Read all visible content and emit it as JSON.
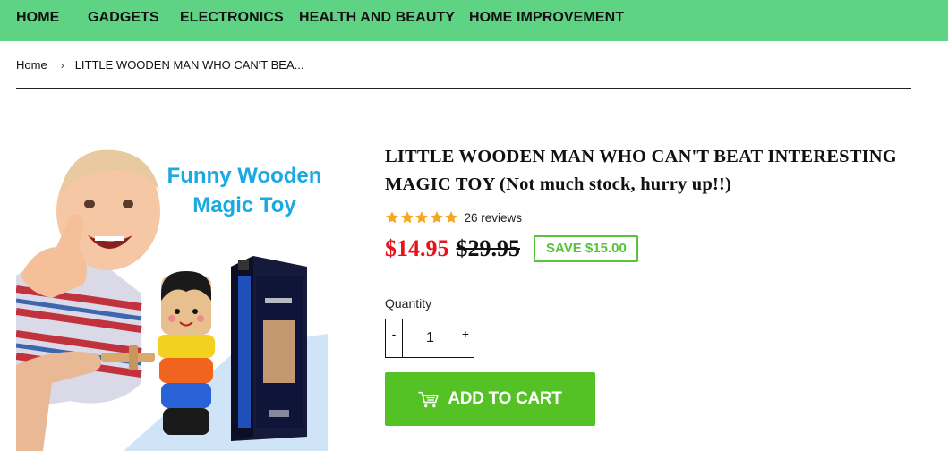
{
  "nav": {
    "items": [
      {
        "label": "HOME"
      },
      {
        "label": "GADGETS"
      },
      {
        "label": "ELECTRONICS"
      },
      {
        "label": "HEALTH AND BEAUTY"
      },
      {
        "label": "HOME IMPROVEMENT"
      }
    ]
  },
  "breadcrumb": {
    "home": "Home",
    "separator": "›",
    "current": "LITTLE WOODEN MAN WHO CAN'T BEA..."
  },
  "product": {
    "image_text_line1": "Funny Wooden",
    "image_text_line2": "Magic Toy",
    "title": "LITTLE WOODEN MAN WHO CAN'T BEAT INTERESTING MAGIC TOY (Not much stock, hurry up!!)",
    "rating": 5,
    "reviews": "26 reviews",
    "price": "$14.95",
    "compare_price": "$29.95",
    "save_badge": "SAVE $15.00",
    "quantity_label": "Quantity",
    "quantity_value": "1",
    "qty_minus": "-",
    "qty_plus": "+",
    "add_to_cart": "ADD TO CART"
  },
  "colors": {
    "nav_bg": "#5ed383",
    "price_red": "#e4141a",
    "accent_green": "#56c338",
    "star_orange": "#f5a623",
    "cart_button": "#54c224"
  },
  "icons": {
    "star": "star-icon",
    "cart": "cart-icon",
    "breadcrumb_separator": "chevron-right-icon"
  }
}
